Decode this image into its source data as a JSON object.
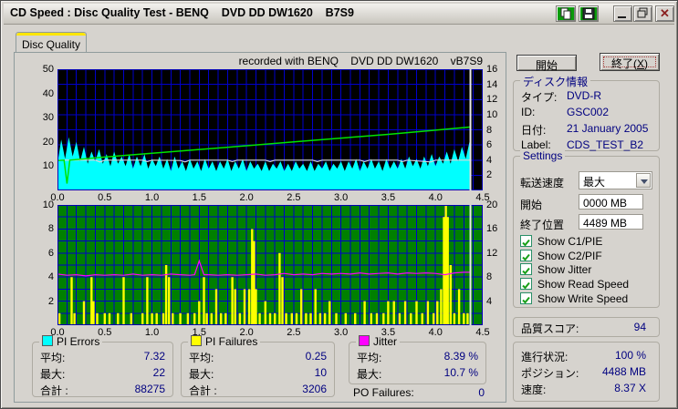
{
  "window": {
    "title": "CD Speed : Disc Quality Test - BENQ    DVD DD DW1620    B7S9",
    "controls": {
      "copy": "copy-report",
      "save": "save-report",
      "minimize": "minimize",
      "restore": "restore",
      "close": "close"
    }
  },
  "tab": {
    "label": "Disc Quality"
  },
  "chart_header": "recorded with BENQ    DVD DD DW1620    vB7S9",
  "chart_data": [
    {
      "type": "area",
      "title": "PI Errors / Read & Write Speed",
      "x": {
        "max": 4.5,
        "minor": 0.1,
        "ticks": [
          0.0,
          0.5,
          1.0,
          1.5,
          2.0,
          2.5,
          3.0,
          3.5,
          4.0,
          4.5
        ]
      },
      "y_left": {
        "max": 50,
        "ticks": [
          10,
          20,
          30,
          40,
          50
        ]
      },
      "y_right": {
        "max": 16,
        "ticks": [
          2,
          4,
          6,
          8,
          10,
          12,
          14,
          16
        ]
      },
      "grid_divs": 8,
      "bg": "#000000",
      "grid_color": "#0000cc",
      "border_color": "#0000b4",
      "cursor_x": 4.37,
      "series": [
        {
          "name": "PI Errors",
          "type": "area",
          "axis": "left",
          "color": "#00ffff",
          "x0": 0,
          "dx": 0.04,
          "values": [
            11,
            21,
            13,
            22,
            14,
            20,
            12,
            18,
            11,
            16,
            12,
            17,
            11,
            15,
            10,
            16,
            11,
            14,
            10,
            15,
            9,
            14,
            10,
            15,
            9,
            13,
            10,
            14,
            9,
            13,
            8,
            14,
            9,
            12,
            8,
            13,
            9,
            12,
            8,
            13,
            9,
            12,
            8,
            12,
            9,
            13,
            8,
            12,
            9,
            13,
            8,
            12,
            9,
            11,
            8,
            12,
            8,
            11,
            9,
            12,
            8,
            11,
            8,
            12,
            9,
            11,
            8,
            12,
            8,
            11,
            9,
            12,
            8,
            11,
            9,
            12,
            8,
            12,
            9,
            13,
            8,
            12,
            9,
            13,
            9,
            12,
            8,
            13,
            9,
            12,
            9,
            13,
            9,
            14,
            10,
            13,
            9,
            14,
            10,
            15,
            10,
            14,
            11,
            16,
            11,
            17,
            12,
            18,
            13,
            20
          ]
        },
        {
          "name": "Write Speed",
          "type": "line",
          "axis": "right",
          "color": "#d9d9d9",
          "width": 1.2,
          "points": [
            [
              0,
              4.0
            ],
            [
              0.4,
              4.0
            ],
            [
              0.45,
              3.75
            ],
            [
              0.5,
              4.0
            ],
            [
              0.9,
              4.0
            ],
            [
              0.95,
              3.8
            ],
            [
              1.0,
              4.0
            ],
            [
              1.3,
              3.95
            ],
            [
              1.35,
              3.75
            ],
            [
              1.4,
              4.0
            ],
            [
              1.8,
              4.0
            ],
            [
              1.85,
              3.8
            ],
            [
              1.9,
              4.0
            ],
            [
              2.2,
              4.0
            ],
            [
              2.25,
              3.8
            ],
            [
              2.3,
              4.0
            ],
            [
              2.7,
              4.0
            ],
            [
              2.75,
              3.8
            ],
            [
              2.8,
              4.0
            ],
            [
              3.2,
              4.0
            ],
            [
              3.25,
              3.8
            ],
            [
              3.3,
              4.0
            ],
            [
              3.6,
              4.0
            ],
            [
              3.65,
              3.8
            ],
            [
              3.7,
              4.0
            ],
            [
              3.95,
              3.75
            ],
            [
              4.0,
              4.0
            ],
            [
              4.37,
              4.0
            ]
          ]
        },
        {
          "name": "Read Speed",
          "type": "line",
          "axis": "right",
          "color": "#00e400",
          "width": 1.5,
          "points": [
            [
              0,
              3.95
            ],
            [
              0.07,
              4.0
            ],
            [
              0.1,
              0.9
            ],
            [
              0.13,
              4.0
            ],
            [
              0.3,
              4.18
            ],
            [
              0.5,
              4.4
            ],
            [
              1.0,
              4.9
            ],
            [
              1.5,
              5.4
            ],
            [
              2.0,
              5.9
            ],
            [
              2.5,
              6.4
            ],
            [
              3.0,
              6.9
            ],
            [
              3.5,
              7.4
            ],
            [
              4.0,
              7.95
            ],
            [
              4.37,
              8.37
            ]
          ]
        }
      ]
    },
    {
      "type": "bar",
      "title": "PI Failures / Jitter",
      "x": {
        "max": 4.5,
        "minor": 0.1,
        "ticks": [
          0.0,
          0.5,
          1.0,
          1.5,
          2.0,
          2.5,
          3.0,
          3.5,
          4.0,
          4.5
        ]
      },
      "y_left": {
        "max": 10,
        "ticks": [
          2,
          4,
          6,
          8,
          10
        ]
      },
      "y_right": {
        "max": 20,
        "ticks": [
          4,
          8,
          12,
          16,
          20
        ]
      },
      "grid_divs": 10,
      "bg": "#008000",
      "grid_color": "#0000cc",
      "border_color": "#0000b4",
      "cursor_x": 4.37,
      "series": [
        {
          "name": "PI Failures",
          "type": "bars",
          "axis": "left",
          "color": "#ffff00",
          "points": [
            [
              0.02,
              1
            ],
            [
              0.15,
              4
            ],
            [
              0.18,
              1
            ],
            [
              0.28,
              2
            ],
            [
              0.36,
              4
            ],
            [
              0.38,
              2
            ],
            [
              0.42,
              1
            ],
            [
              0.5,
              1
            ],
            [
              0.55,
              1
            ],
            [
              0.64,
              1
            ],
            [
              0.7,
              4
            ],
            [
              0.78,
              1
            ],
            [
              0.9,
              1
            ],
            [
              0.95,
              4
            ],
            [
              1.0,
              1
            ],
            [
              1.05,
              1
            ],
            [
              1.12,
              1
            ],
            [
              1.15,
              5
            ],
            [
              1.18,
              4
            ],
            [
              1.22,
              1
            ],
            [
              1.3,
              1
            ],
            [
              1.38,
              1
            ],
            [
              1.45,
              1
            ],
            [
              1.5,
              2
            ],
            [
              1.55,
              4
            ],
            [
              1.58,
              1
            ],
            [
              1.63,
              1
            ],
            [
              1.68,
              3
            ],
            [
              1.73,
              1
            ],
            [
              1.78,
              1
            ],
            [
              1.85,
              4
            ],
            [
              1.88,
              3
            ],
            [
              1.93,
              1
            ],
            [
              1.98,
              3
            ],
            [
              2.03,
              3
            ],
            [
              2.06,
              8
            ],
            [
              2.08,
              7
            ],
            [
              2.1,
              3
            ],
            [
              2.14,
              1
            ],
            [
              2.2,
              2
            ],
            [
              2.25,
              1
            ],
            [
              2.3,
              1
            ],
            [
              2.35,
              6
            ],
            [
              2.38,
              4
            ],
            [
              2.42,
              1
            ],
            [
              2.48,
              1
            ],
            [
              2.53,
              1
            ],
            [
              2.58,
              3
            ],
            [
              2.63,
              1
            ],
            [
              2.68,
              1
            ],
            [
              2.73,
              3
            ],
            [
              2.78,
              1
            ],
            [
              2.83,
              1
            ],
            [
              2.88,
              2
            ],
            [
              2.95,
              1
            ],
            [
              3.05,
              1
            ],
            [
              3.15,
              1
            ],
            [
              3.25,
              2
            ],
            [
              3.32,
              1
            ],
            [
              3.38,
              1
            ],
            [
              3.45,
              1
            ],
            [
              3.5,
              2
            ],
            [
              3.56,
              2
            ],
            [
              3.62,
              1
            ],
            [
              3.68,
              2
            ],
            [
              3.74,
              1
            ],
            [
              3.8,
              2
            ],
            [
              3.86,
              1
            ],
            [
              3.92,
              2
            ],
            [
              3.98,
              1
            ],
            [
              4.02,
              2
            ],
            [
              4.06,
              3
            ],
            [
              4.09,
              9
            ],
            [
              4.11,
              10
            ],
            [
              4.13,
              9
            ],
            [
              4.16,
              5
            ],
            [
              4.2,
              1
            ],
            [
              4.25,
              3
            ],
            [
              4.3,
              1
            ],
            [
              4.34,
              1
            ]
          ]
        },
        {
          "name": "Jitter",
          "type": "line",
          "axis": "right",
          "color": "#ff00ff",
          "width": 1.2,
          "points": [
            [
              0,
              8.5
            ],
            [
              0.1,
              8.3
            ],
            [
              0.2,
              8.4
            ],
            [
              0.3,
              8.2
            ],
            [
              0.4,
              8.4
            ],
            [
              0.5,
              8.3
            ],
            [
              0.6,
              8.4
            ],
            [
              0.7,
              8.3
            ],
            [
              0.8,
              8.5
            ],
            [
              0.9,
              8.3
            ],
            [
              1.0,
              8.4
            ],
            [
              1.1,
              8.3
            ],
            [
              1.2,
              8.5
            ],
            [
              1.3,
              8.4
            ],
            [
              1.4,
              8.3
            ],
            [
              1.45,
              8.4
            ],
            [
              1.5,
              10.7
            ],
            [
              1.55,
              8.4
            ],
            [
              1.6,
              8.4
            ],
            [
              1.7,
              8.3
            ],
            [
              1.8,
              8.4
            ],
            [
              1.9,
              8.3
            ],
            [
              2.0,
              8.4
            ],
            [
              2.1,
              8.5
            ],
            [
              2.2,
              8.3
            ],
            [
              2.3,
              8.4
            ],
            [
              2.4,
              8.6
            ],
            [
              2.5,
              8.4
            ],
            [
              2.6,
              8.5
            ],
            [
              2.7,
              8.4
            ],
            [
              2.8,
              8.6
            ],
            [
              2.9,
              8.5
            ],
            [
              3.0,
              8.6
            ],
            [
              3.1,
              8.5
            ],
            [
              3.2,
              8.7
            ],
            [
              3.3,
              8.5
            ],
            [
              3.4,
              8.6
            ],
            [
              3.5,
              8.7
            ],
            [
              3.6,
              8.5
            ],
            [
              3.7,
              8.7
            ],
            [
              3.8,
              8.6
            ],
            [
              3.9,
              8.7
            ],
            [
              4.0,
              8.6
            ],
            [
              4.1,
              8.4
            ],
            [
              4.2,
              8.7
            ],
            [
              4.3,
              8.8
            ],
            [
              4.36,
              8.8
            ]
          ]
        }
      ]
    }
  ],
  "legend": {
    "pi_errors": {
      "title": "PI Errors",
      "color": "#00ffff",
      "avg_label": "平均:",
      "avg": "7.32",
      "max_label": "最大:",
      "max": "22",
      "total_label": "合計 :",
      "total": "88275"
    },
    "pi_failures": {
      "title": "PI Failures",
      "color": "#ffff00",
      "avg_label": "平均:",
      "avg": "0.25",
      "max_label": "最大:",
      "max": "10",
      "total_label": "合計 :",
      "total": "3206"
    },
    "jitter": {
      "title": "Jitter",
      "color": "#ff00ff",
      "avg_label": "平均:",
      "avg": "8.39 %",
      "max_label": "最大:",
      "max": "10.7 %"
    },
    "po_failures": {
      "label": "PO Failures:",
      "value": "0"
    }
  },
  "side": {
    "start_button": "開始",
    "exit_button_pre": "終了(",
    "exit_button_key": "X",
    "exit_button_post": ")",
    "disc_info": {
      "title": "ディスク情報",
      "type_label": "タイプ:",
      "type": "DVD-R",
      "id_label": "ID:",
      "id": "GSC002",
      "date_label": "日付:",
      "date": "21 January 2005",
      "label_label": "Label:",
      "label": "CDS_TEST_B2"
    },
    "settings": {
      "title": "Settings",
      "speed_label": "転送速度",
      "speed_value": "最大",
      "start_label": "開始",
      "start_value": "0000 MB",
      "end_label": "終了位置",
      "end_value": "4489 MB",
      "checkboxes": [
        {
          "label": "Show C1/PIE",
          "checked": true
        },
        {
          "label": "Show C2/PIF",
          "checked": true
        },
        {
          "label": "Show Jitter",
          "checked": true
        },
        {
          "label": "Show Read Speed",
          "checked": true
        },
        {
          "label": "Show Write Speed",
          "checked": true
        }
      ]
    },
    "score": {
      "label": "品質スコア:",
      "value": "94"
    },
    "progress": {
      "progress_label": "進行状況:",
      "progress": "100 %",
      "position_label": "ポジション:",
      "position": "4488 MB",
      "speed_label": "速度:",
      "speed": "8.37 X"
    }
  },
  "colors": {
    "window_bg": "#d6d3ce",
    "value_text": "#000080",
    "pi_errors": "#00ffff",
    "pi_failures": "#ffff00",
    "jitter": "#ff00ff",
    "read_speed": "#00e400",
    "write_speed": "#d9d9d9",
    "chart1_bg": "#000000",
    "chart2_bg": "#008000",
    "grid": "#0000cc",
    "tab_hot": "#ffe600"
  }
}
